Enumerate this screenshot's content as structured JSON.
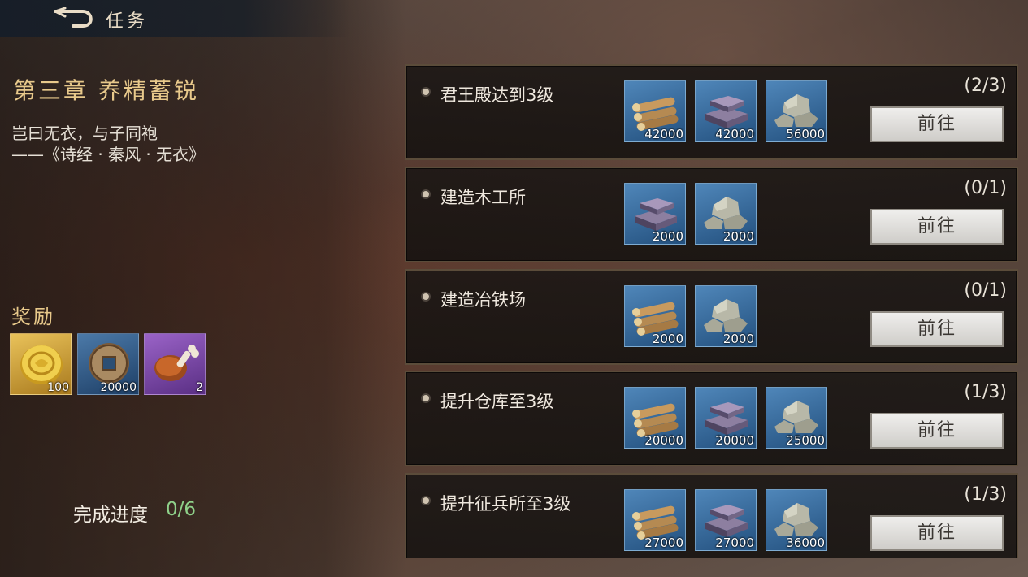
{
  "header": {
    "title": "任务"
  },
  "chapter": {
    "title": "第三章 养精蓄锐",
    "quote_line1": "岂曰无衣，与子同袍",
    "quote_line2": "——《诗经 · 秦风 · 无衣》"
  },
  "rewards": {
    "label": "奖励",
    "items": [
      {
        "icon": "gold-coin-icon",
        "count": "100"
      },
      {
        "icon": "copper-coin-icon",
        "count": "20000"
      },
      {
        "icon": "meat-icon",
        "count": "2"
      }
    ]
  },
  "progress": {
    "label": "完成进度",
    "value": "0/6"
  },
  "quests": [
    {
      "name": "君王殿达到3级",
      "count": "(2/3)",
      "button": "前往",
      "resources": [
        {
          "type": "wood",
          "amount": "42000"
        },
        {
          "type": "iron",
          "amount": "42000"
        },
        {
          "type": "stone",
          "amount": "56000"
        }
      ]
    },
    {
      "name": "建造木工所",
      "count": "(0/1)",
      "button": "前往",
      "resources": [
        {
          "type": "iron",
          "amount": "2000"
        },
        {
          "type": "stone",
          "amount": "2000"
        }
      ]
    },
    {
      "name": "建造冶铁场",
      "count": "(0/1)",
      "button": "前往",
      "resources": [
        {
          "type": "wood",
          "amount": "2000"
        },
        {
          "type": "stone",
          "amount": "2000"
        }
      ]
    },
    {
      "name": "提升仓库至3级",
      "count": "(1/3)",
      "button": "前往",
      "resources": [
        {
          "type": "wood",
          "amount": "20000"
        },
        {
          "type": "iron",
          "amount": "20000"
        },
        {
          "type": "stone",
          "amount": "25000"
        }
      ]
    },
    {
      "name": "提升征兵所至3级",
      "count": "(1/3)",
      "button": "前往",
      "resources": [
        {
          "type": "wood",
          "amount": "27000"
        },
        {
          "type": "iron",
          "amount": "27000"
        },
        {
          "type": "stone",
          "amount": "36000"
        }
      ]
    }
  ],
  "colors": {
    "accent_gold": "#e8c98b",
    "progress_green": "#8fd18a",
    "slot_blue": "#3c6e9c"
  }
}
